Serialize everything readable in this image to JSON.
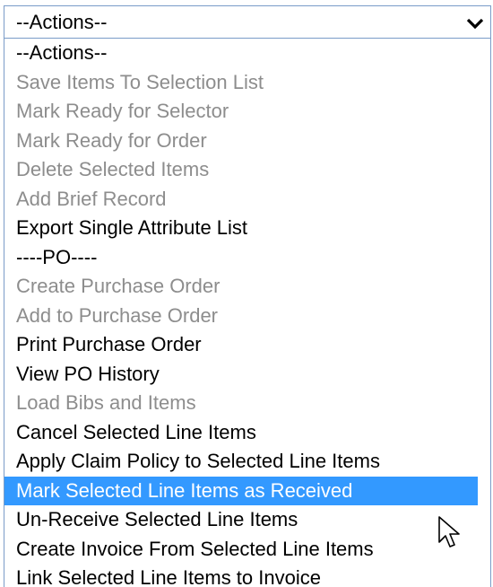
{
  "select": {
    "value": "--Actions--",
    "icon": "chevron-down-icon"
  },
  "options": [
    {
      "label": "--Actions--",
      "disabled": false,
      "selected": false
    },
    {
      "label": "Save Items To Selection List",
      "disabled": true,
      "selected": false
    },
    {
      "label": "Mark Ready for Selector",
      "disabled": true,
      "selected": false
    },
    {
      "label": "Mark Ready for Order",
      "disabled": true,
      "selected": false
    },
    {
      "label": "Delete Selected Items",
      "disabled": true,
      "selected": false
    },
    {
      "label": "Add Brief Record",
      "disabled": true,
      "selected": false
    },
    {
      "label": "Export Single Attribute List",
      "disabled": false,
      "selected": false
    },
    {
      "label": "----PO----",
      "disabled": false,
      "selected": false
    },
    {
      "label": "Create Purchase Order",
      "disabled": true,
      "selected": false
    },
    {
      "label": "Add to Purchase Order",
      "disabled": true,
      "selected": false
    },
    {
      "label": "Print Purchase Order",
      "disabled": false,
      "selected": false
    },
    {
      "label": "View PO History",
      "disabled": false,
      "selected": false
    },
    {
      "label": "Load Bibs and Items",
      "disabled": true,
      "selected": false
    },
    {
      "label": "Cancel Selected Line Items",
      "disabled": false,
      "selected": false
    },
    {
      "label": "Apply Claim Policy to Selected Line Items",
      "disabled": false,
      "selected": false
    },
    {
      "label": "Mark Selected Line Items as Received",
      "disabled": false,
      "selected": true
    },
    {
      "label": "Un-Receive Selected Line Items",
      "disabled": false,
      "selected": false
    },
    {
      "label": "Create Invoice From Selected Line Items",
      "disabled": false,
      "selected": false
    },
    {
      "label": "Link Selected Line Items to Invoice",
      "disabled": false,
      "selected": false
    }
  ],
  "colors": {
    "highlight": "#3399ff",
    "disabled_text": "#8d8d8d",
    "border": "#7a9cc8"
  },
  "cursor_icon": "mouse-pointer-icon"
}
